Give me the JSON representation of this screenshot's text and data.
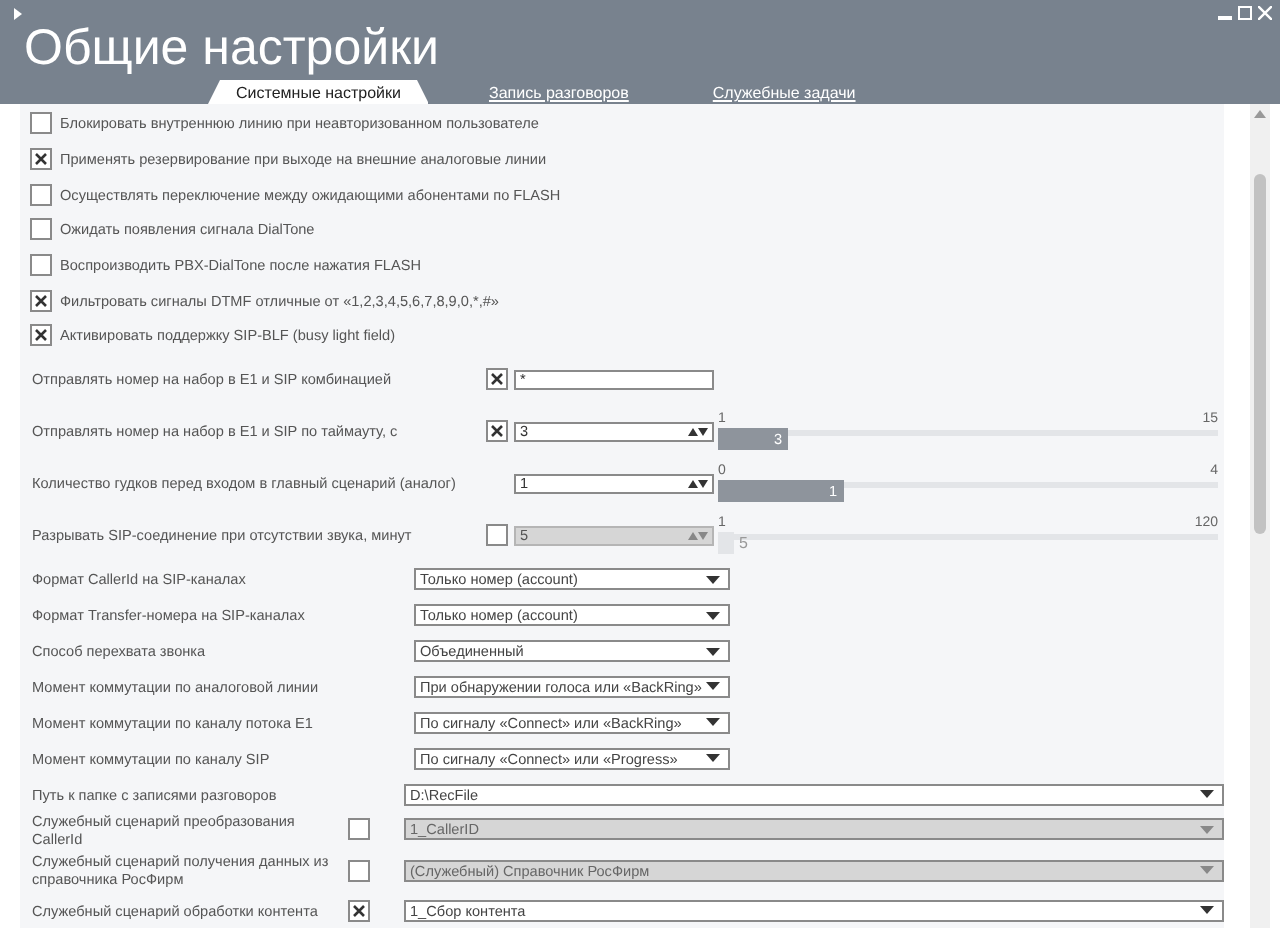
{
  "window": {
    "title": "Общие настройки"
  },
  "tabs": [
    {
      "label": "Системные настройки",
      "selected": true
    },
    {
      "label": "Запись разговоров",
      "selected": false
    },
    {
      "label": "Служебные задачи",
      "selected": false
    }
  ],
  "options": [
    {
      "label": "Блокировать внутреннюю линию при неавторизованном пользователе",
      "checked": false
    },
    {
      "label": "Применять резервирование при выходе на внешние аналоговые линии",
      "checked": true
    },
    {
      "label": "Осуществлять переключение между ожидающими абонентами по FLASH",
      "checked": false
    },
    {
      "label": "Ожидать появления сигнала DialTone",
      "checked": false
    },
    {
      "label": "Воспроизводить PBX-DialTone после нажатия FLASH",
      "checked": false
    },
    {
      "label": "Фильтровать сигналы DTMF отличные от «1,2,3,4,5,6,7,8,9,0,*,#»",
      "checked": true
    },
    {
      "label": "Активировать поддержку SIP-BLF (busy light field)",
      "checked": true
    }
  ],
  "number_settings": [
    {
      "kind": "text",
      "label": "Отправлять номер на набор в E1 и SIP комбинацией",
      "checked": true,
      "value": "*"
    },
    {
      "kind": "spin",
      "label": "Отправлять номер на набор в E1 и SIP по таймауту, с",
      "checked": true,
      "value": "3",
      "slider": {
        "min": "1",
        "max": "15",
        "level": 0.14,
        "reading": "3"
      }
    },
    {
      "kind": "spin",
      "label": "Количество гудков перед входом в главный сценарий (аналог)",
      "value": "1",
      "slider": {
        "min": "0",
        "max": "4",
        "level": 0.25,
        "reading": "1"
      }
    },
    {
      "kind": "spin",
      "label": "Разрывать SIP-соединение при отсутствии звука, минут",
      "checked": false,
      "value": "5",
      "slider": {
        "min": "1",
        "max": "120",
        "level": 0.03,
        "reading": "5"
      }
    }
  ],
  "select_settings": [
    {
      "kind": "short",
      "label": "Формат CallerId на SIP-каналах",
      "value": "Только номер (account)"
    },
    {
      "kind": "short",
      "label": "Формат Transfer-номера на SIP-каналах",
      "value": "Только номер (account)"
    },
    {
      "kind": "short",
      "label": "Способ перехвата звонка",
      "value": "Объединенный"
    },
    {
      "kind": "short",
      "label": "Момент коммутации по аналоговой линии",
      "value": "При обнаружении голоса или «BackRing»"
    },
    {
      "kind": "short",
      "label": "Момент коммутации по каналу потока E1",
      "value": "По сигналу «Connect» или «BackRing»"
    },
    {
      "kind": "short",
      "label": "Момент коммутации по каналу SIP",
      "value": "По сигналу «Connect» или «Progress»"
    },
    {
      "kind": "wide",
      "label": "Путь к папке с записями разговоров",
      "value": "D:\\RecFile"
    },
    {
      "kind": "wide",
      "label": "Служебный сценарий преобразования CallerId",
      "checked": false,
      "value": "1_CallerID"
    },
    {
      "kind": "wide",
      "label": "Служебный сценарий получения данных из справочника РосФирм",
      "checked": false,
      "value": "(Служебный) Справочник РосФирм"
    },
    {
      "kind": "wide",
      "label": "Служебный сценарий обработки контента",
      "checked": true,
      "value": "1_Сбор контента"
    }
  ]
}
